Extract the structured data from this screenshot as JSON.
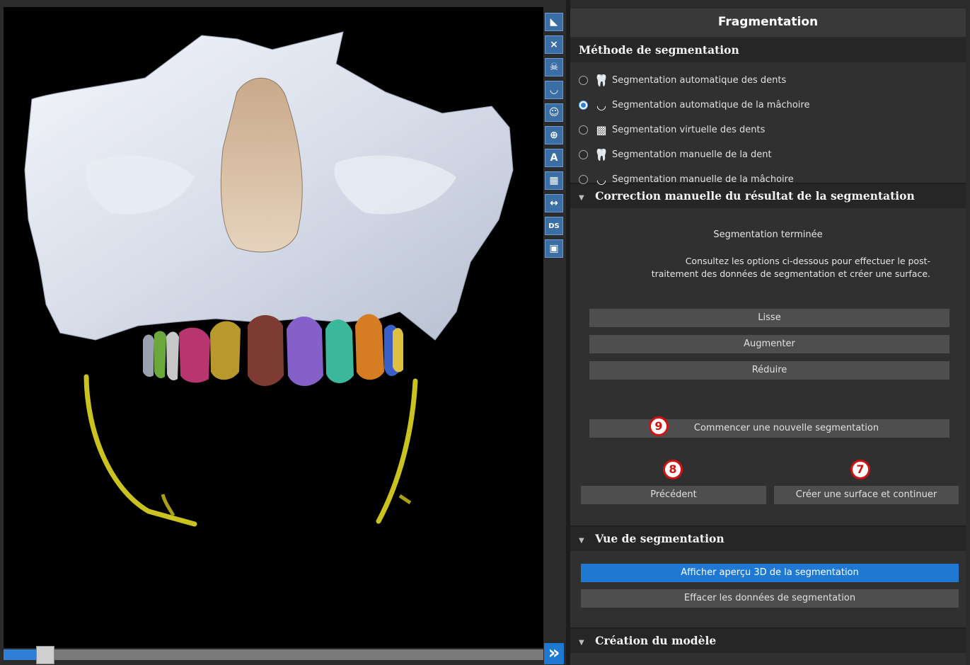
{
  "panel": {
    "title": "Fragmentation"
  },
  "method": {
    "header": "Méthode de segmentation",
    "options": [
      {
        "label": "Segmentation automatique des dents",
        "icon": "tooth-auto-icon",
        "selected": false
      },
      {
        "label": "Segmentation automatique de la mâchoire",
        "icon": "jaw-auto-icon",
        "selected": true
      },
      {
        "label": "Segmentation virtuelle des dents",
        "icon": "tooth-virtual-icon",
        "selected": false
      },
      {
        "label": "Segmentation manuelle de la dent",
        "icon": "tooth-manual-icon",
        "selected": false
      },
      {
        "label": "Segmentation manuelle de la mâchoire",
        "icon": "jaw-manual-icon",
        "selected": false
      }
    ]
  },
  "correction": {
    "header": "Correction manuelle du résultat de la segmentation",
    "status": "Segmentation terminée",
    "info_line1": "Consultez les options ci-dessous pour effectuer le post-",
    "info_line2": "traitement des données de segmentation et créer une surface.",
    "smooth": "Lisse",
    "increase": "Augmenter",
    "reduce": "Réduire",
    "new_segmentation": "Commencer une nouvelle segmentation",
    "previous": "Précédent",
    "create_surface": "Créer une surface et continuer",
    "badges": {
      "new_segmentation": "9",
      "previous": "8",
      "create_surface": "7"
    }
  },
  "view": {
    "header": "Vue de segmentation",
    "preview_3d": "Afficher aperçu 3D de la segmentation",
    "clear": "Effacer les données de segmentation"
  },
  "model": {
    "header": "Création du modèle"
  },
  "toolbar": {
    "icons": [
      "crop-icon",
      "cut-plane-icon",
      "skull-icon",
      "jaw-arch-icon",
      "face-icon",
      "orientation-icon",
      "annotation-a-icon",
      "grid-icon",
      "measure-icon",
      "ds-icon",
      "screenshot-icon"
    ],
    "labels": {
      "annotation": "A",
      "ds": "DS"
    }
  },
  "slider": {
    "value_fraction": 0.06
  },
  "colors": {
    "accent": "#1f78d1",
    "badge_border": "#d11212"
  }
}
